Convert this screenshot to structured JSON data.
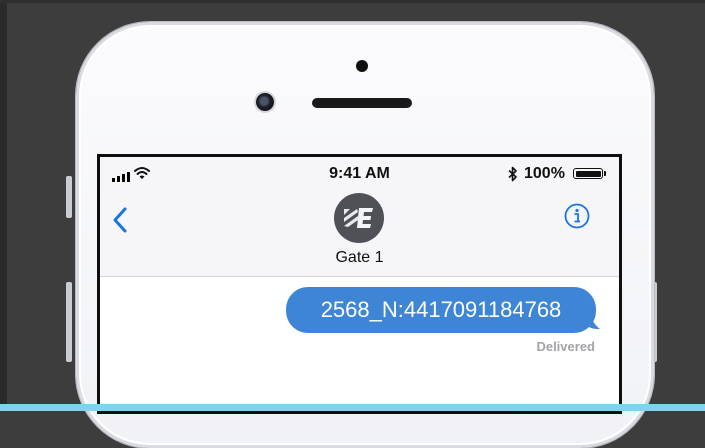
{
  "status_bar": {
    "time": "9:41 AM",
    "battery_percent": "100%",
    "battery_level": 1.0,
    "icons": [
      "signal-icon",
      "wifi-icon",
      "bluetooth-icon",
      "battery-icon"
    ]
  },
  "conversation": {
    "contact_name": "Gate 1",
    "avatar_letters": "E",
    "back_icon": "chevron-left-icon",
    "info_icon": "info-icon"
  },
  "messages": [
    {
      "text": "2568_N:4417091184768",
      "status": "Delivered",
      "direction": "outgoing"
    }
  ],
  "colors": {
    "accent": "#1a73e8",
    "bubble": "#3f85d6",
    "background": "#3d3d3d",
    "bottom_band": "#7fd3ee"
  }
}
